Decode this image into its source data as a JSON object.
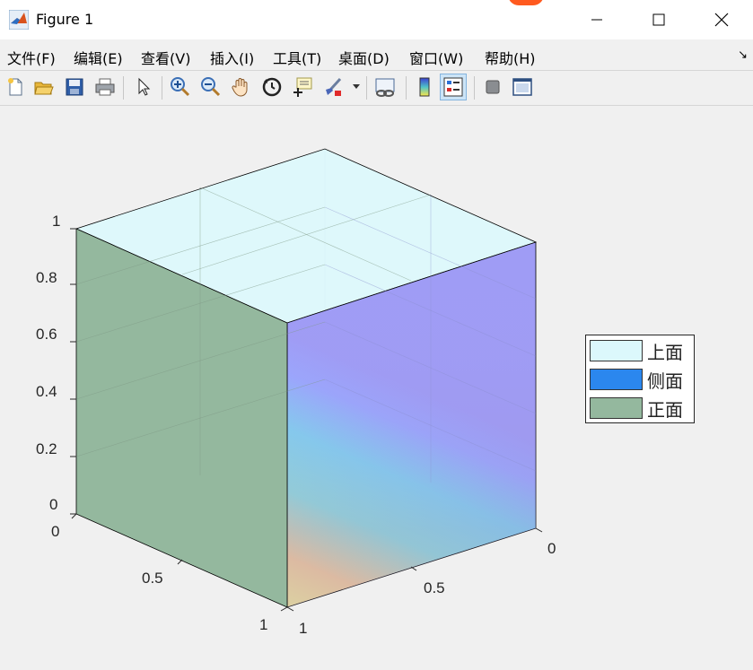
{
  "window": {
    "title": "Figure 1",
    "controls": [
      "minimize",
      "maximize",
      "close"
    ]
  },
  "menu": [
    {
      "label": "文件(F)"
    },
    {
      "label": "编辑(E)"
    },
    {
      "label": "查看(V)"
    },
    {
      "label": "插入(I)"
    },
    {
      "label": "工具(T)"
    },
    {
      "label": "桌面(D)"
    },
    {
      "label": "窗口(W)"
    },
    {
      "label": "帮助(H)"
    }
  ],
  "toolbar": {
    "buttons": [
      {
        "icon": "new-figure-icon"
      },
      {
        "icon": "open-file-icon"
      },
      {
        "icon": "save-icon"
      },
      {
        "icon": "print-icon"
      },
      {
        "icon": "select-arrow-icon"
      },
      {
        "icon": "zoom-in-icon"
      },
      {
        "icon": "zoom-out-icon"
      },
      {
        "icon": "pan-hand-icon"
      },
      {
        "icon": "rotate-3d-icon"
      },
      {
        "icon": "data-cursor-icon"
      },
      {
        "icon": "brush-icon"
      },
      {
        "icon": "link-plot-icon"
      },
      {
        "icon": "colorbar-icon"
      },
      {
        "icon": "legend-icon"
      },
      {
        "icon": "hide-plot-tools-icon"
      },
      {
        "icon": "show-plot-tools-icon"
      }
    ],
    "pressed": "legend-icon"
  },
  "axes": {
    "z_ticks": [
      "0",
      "0.2",
      "0.4",
      "0.6",
      "0.8",
      "1"
    ],
    "x_ticks": [
      "0",
      "0.5",
      "1"
    ],
    "y_ticks": [
      "1",
      "0.5",
      "0"
    ],
    "grid": true
  },
  "chart_data": {
    "type": "surface",
    "xlim": [
      0,
      1
    ],
    "ylim": [
      0,
      1
    ],
    "zlim": [
      0,
      1
    ],
    "series": [
      {
        "name": "上面",
        "color": "#d9f7fb",
        "face": "top (z=1)"
      },
      {
        "name": "侧面",
        "color": "#2b87ee",
        "face": "side (y=0)"
      },
      {
        "name": "正面",
        "color": "#94b89e",
        "face": "front (x=0)"
      }
    ]
  },
  "legend": {
    "items": [
      {
        "label": "上面",
        "color": "#dcf8fc"
      },
      {
        "label": "侧面",
        "color": "#2b87ee"
      },
      {
        "label": "正面",
        "color": "#94b89e"
      }
    ]
  }
}
